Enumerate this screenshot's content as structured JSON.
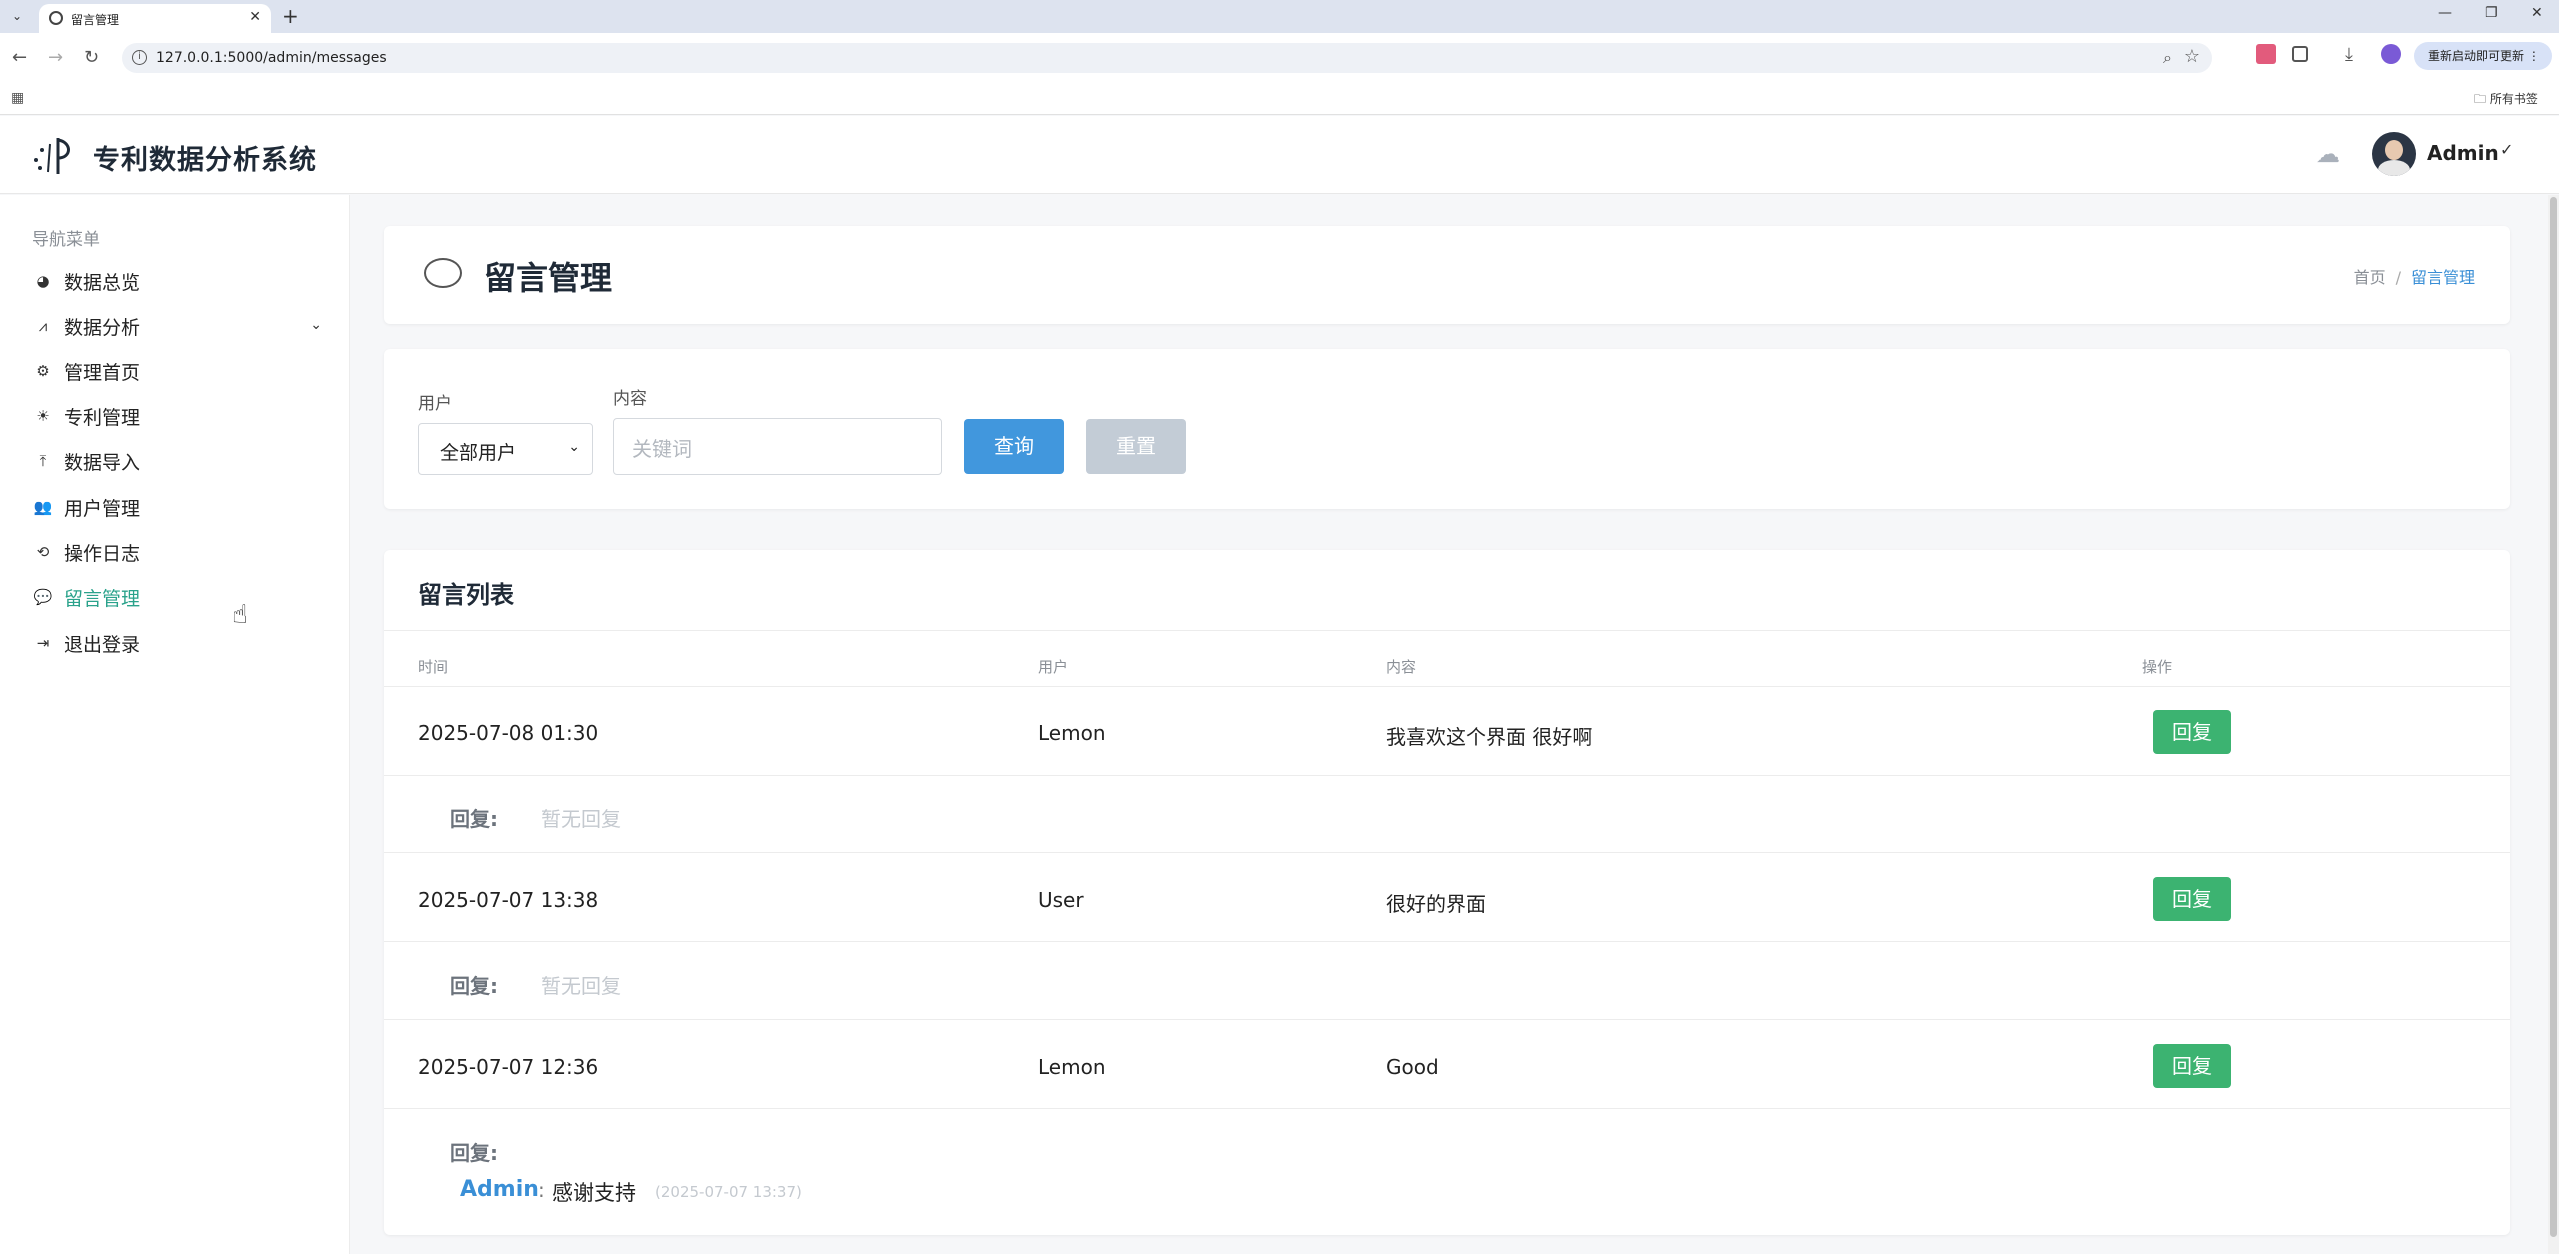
{
  "browser": {
    "tab_title": "留言管理",
    "url": "127.0.0.1:5000/admin/messages",
    "update_button": "重新启动即可更新",
    "bookmarks_folder": "所有书签",
    "window_controls": [
      "minimize-icon",
      "restore-icon",
      "close-icon"
    ]
  },
  "app": {
    "title": "专利数据分析系统",
    "user_name": "Admin"
  },
  "sidebar": {
    "heading": "导航菜单",
    "items": [
      {
        "label": "数据总览",
        "icon": "pie-chart-icon"
      },
      {
        "label": "数据分析",
        "icon": "line-chart-icon"
      },
      {
        "label": "管理首页",
        "icon": "gears-icon"
      },
      {
        "label": "专利管理",
        "icon": "lightbulb-icon"
      },
      {
        "label": "数据导入",
        "icon": "upload-icon"
      },
      {
        "label": "用户管理",
        "icon": "users-icon"
      },
      {
        "label": "操作日志",
        "icon": "history-icon"
      },
      {
        "label": "留言管理",
        "icon": "comments-icon",
        "active": true
      },
      {
        "label": "退出登录",
        "icon": "logout-icon"
      }
    ]
  },
  "page": {
    "title": "留言管理",
    "breadcrumb": [
      "首页",
      "/",
      "留言管理"
    ]
  },
  "filter": {
    "user_label": "用户",
    "user_selected": "全部用户",
    "content_label": "内容",
    "content_placeholder": "关键词",
    "query_button": "查询",
    "reset_button": "重置"
  },
  "list": {
    "title": "留言列表",
    "columns": [
      "时间",
      "用户",
      "内容",
      "操作"
    ],
    "reply_label": "回复:",
    "no_reply": "暂无回复",
    "action_label": "回复",
    "rows": [
      {
        "time": "2025-07-08 01:30",
        "user": "Lemon",
        "content": "我喜欢这个界面 很好啊"
      },
      {
        "time": "2025-07-07 13:38",
        "user": "User",
        "content": "很好的界面"
      },
      {
        "time": "2025-07-07 12:36",
        "user": "Lemon",
        "content": "Good",
        "reply": {
          "author": "Admin",
          "colon": ":",
          "text": "感谢支持",
          "time": "(2025-07-07 13:37)"
        }
      }
    ]
  },
  "colors": {
    "accent_green": "#2aa28b",
    "primary_blue": "#4197dd",
    "reply_button_green": "#3cb371",
    "link_blue": "#3a8fd6"
  }
}
